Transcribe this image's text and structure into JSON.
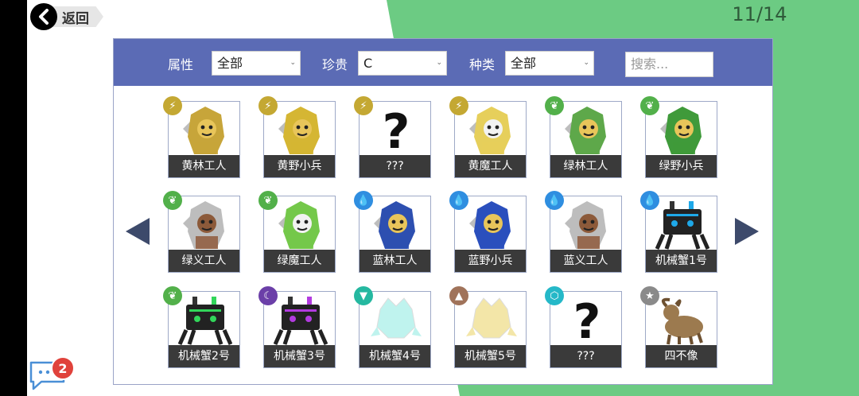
{
  "header": {
    "back_label": "返回",
    "page_counter": "11/14"
  },
  "filters": {
    "attribute_label": "属性",
    "attribute_value": "全部",
    "rarity_label": "珍贵",
    "rarity_value": "C",
    "type_label": "种类",
    "type_value": "全部",
    "search_placeholder": "搜索..."
  },
  "cards": [
    {
      "name": "黄林工人",
      "element": "lightning",
      "badge_color": "#c4a833",
      "art": "worker",
      "tint": "#c7a53a"
    },
    {
      "name": "黄野小兵",
      "element": "lightning",
      "badge_color": "#c4a833",
      "art": "goblin",
      "tint": "#d5b633"
    },
    {
      "name": "???",
      "element": "lightning",
      "badge_color": "#c4a833",
      "art": "unknown",
      "tint": "#222222"
    },
    {
      "name": "黄魔工人",
      "element": "lightning",
      "badge_color": "#c4a833",
      "art": "skeleton",
      "tint": "#e6cf5b"
    },
    {
      "name": "绿林工人",
      "element": "leaf",
      "badge_color": "#52b04a",
      "art": "worker",
      "tint": "#5ea84a"
    },
    {
      "name": "绿野小兵",
      "element": "leaf",
      "badge_color": "#52b04a",
      "art": "goblin",
      "tint": "#3f9a3a"
    },
    {
      "name": "绿义工人",
      "element": "leaf",
      "badge_color": "#52b04a",
      "art": "knight",
      "tint": "#8f5a3c"
    },
    {
      "name": "绿魔工人",
      "element": "leaf",
      "badge_color": "#52b04a",
      "art": "skeleton",
      "tint": "#74c84a"
    },
    {
      "name": "蓝林工人",
      "element": "water",
      "badge_color": "#2f8ee0",
      "art": "worker",
      "tint": "#2d4fb0"
    },
    {
      "name": "蓝野小兵",
      "element": "water",
      "badge_color": "#2f8ee0",
      "art": "goblin",
      "tint": "#2a4fbd"
    },
    {
      "name": "蓝义工人",
      "element": "water",
      "badge_color": "#2f8ee0",
      "art": "knight",
      "tint": "#8f5a3c"
    },
    {
      "name": "机械蟹1号",
      "element": "water",
      "badge_color": "#2f8ee0",
      "art": "crab",
      "tint": "#1ea8e8"
    },
    {
      "name": "机械蟹2号",
      "element": "leaf",
      "badge_color": "#52b04a",
      "art": "crab",
      "tint": "#32d65a"
    },
    {
      "name": "机械蟹3号",
      "element": "moon",
      "badge_color": "#6b3fa8",
      "art": "crab",
      "tint": "#b23be0"
    },
    {
      "name": "机械蟹4号",
      "element": "wind",
      "badge_color": "#25b8a0",
      "art": "crystal",
      "tint": "#bff3ee"
    },
    {
      "name": "机械蟹5号",
      "element": "earth",
      "badge_color": "#a0735a",
      "art": "crystal",
      "tint": "#f3e6a8"
    },
    {
      "name": "???",
      "element": "hex",
      "badge_color": "#25b8c8",
      "art": "unknown",
      "tint": "#222222"
    },
    {
      "name": "四不像",
      "element": "star",
      "badge_color": "#8a8a8a",
      "art": "beast",
      "tint": "#9c7a4f"
    }
  ],
  "chat": {
    "unread_count": "2"
  }
}
